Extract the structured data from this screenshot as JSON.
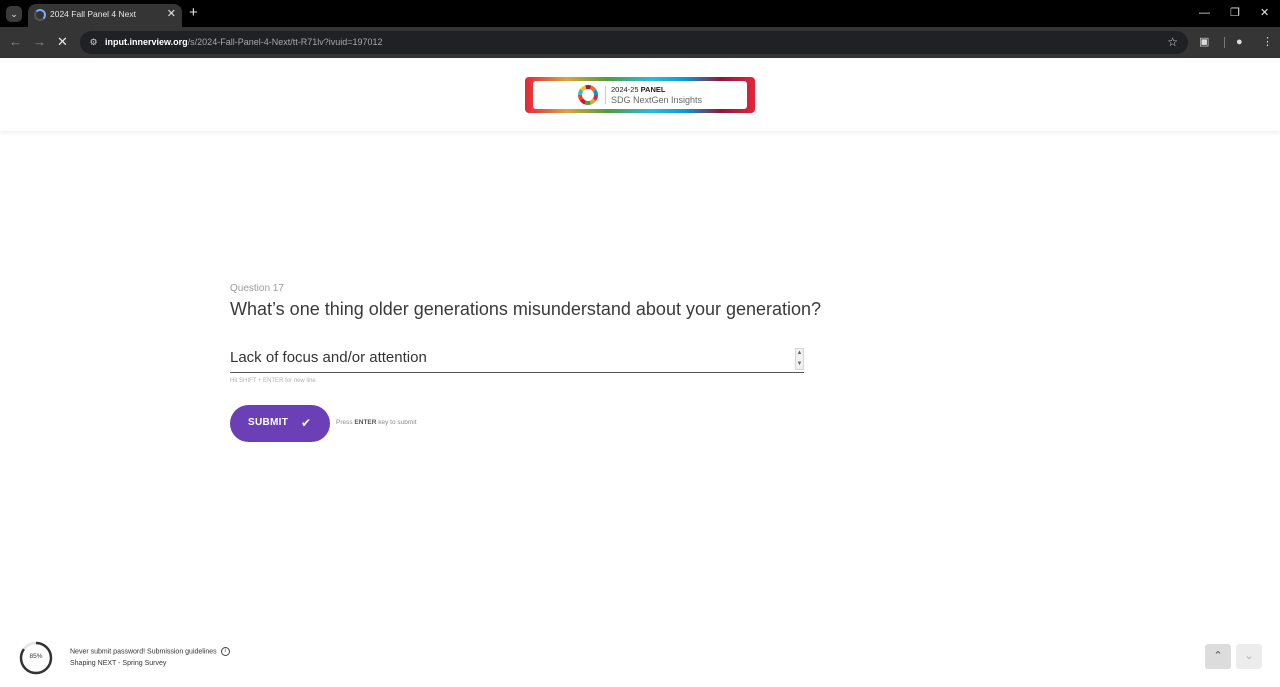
{
  "browser": {
    "tab_title": "2024 Fall Panel 4 Next",
    "url_host": "input.innerview.org",
    "url_path": "/s/2024-Fall-Panel-4-Next/tt-R71lv?ivuid=197012"
  },
  "logo": {
    "line1_prefix": "2024-25 ",
    "line1_bold": "PANEL",
    "line2": "SDG NextGen Insights"
  },
  "question": {
    "number_label": "Question 17",
    "text": "What’s one thing older generations misunderstand about your generation?",
    "answer_value": "Lack of focus and/or attention",
    "hint": "Hit SHIFT + ENTER for new line"
  },
  "submit": {
    "label": "SUBMIT",
    "hint_prefix": "Press ",
    "hint_key": "ENTER",
    "hint_suffix": " key to submit"
  },
  "footer": {
    "progress_percent": 85,
    "progress_label": "85%",
    "notice": "Never submit password! Submission guidelines",
    "survey_name": "Shaping NEXT - Spring Survey"
  },
  "colors": {
    "accent": "#6b3fb5",
    "chrome_dark": "#353535"
  },
  "icons": {
    "tab_search": "chevron-down-icon",
    "loading": "spinner-icon",
    "back": "arrow-left-icon",
    "forward": "arrow-right-icon",
    "stop": "close-icon",
    "bookmark": "star-icon",
    "submit": "checkmark-icon",
    "info": "info-icon",
    "nav_up": "chevron-up-icon",
    "nav_down": "chevron-down-icon"
  }
}
